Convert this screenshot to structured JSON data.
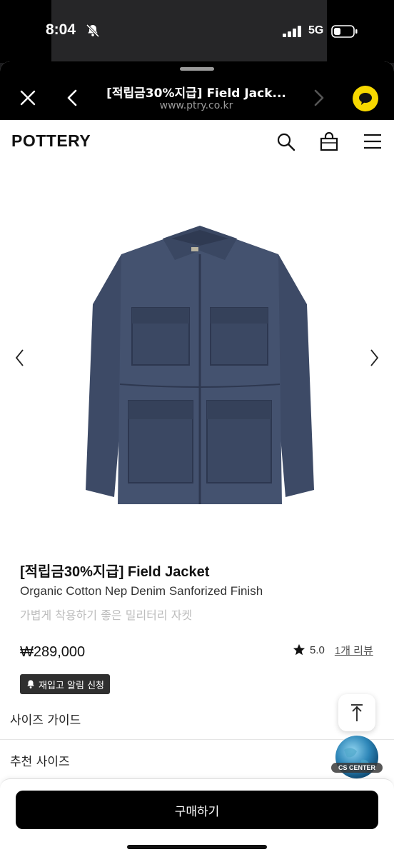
{
  "status_bar": {
    "time": "8:04",
    "network": "5G"
  },
  "browser": {
    "page_title": "[적립금30%지급] Field Jack...",
    "domain": "www.ptry.co.kr"
  },
  "site": {
    "logo": "POTTERY"
  },
  "product": {
    "title": "[적립금30%지급] Field Jacket",
    "subtitle": "Organic Cotton Nep Denim Sanforized Finish",
    "description": "가볍게 착용하기 좋은 밀리터리 자켓",
    "price": "₩289,000",
    "rating": "5.0",
    "review_link": "1개 리뷰",
    "restock_label": "재입고 알림 신청"
  },
  "rows": {
    "size_guide": "사이즈 가이드",
    "recommended_size": "추천 사이즈"
  },
  "cs_badge": "CS CENTER",
  "buy_button": "구매하기",
  "colors": {
    "accent_kakao": "#f7d800",
    "denim": "#3f4d68"
  }
}
